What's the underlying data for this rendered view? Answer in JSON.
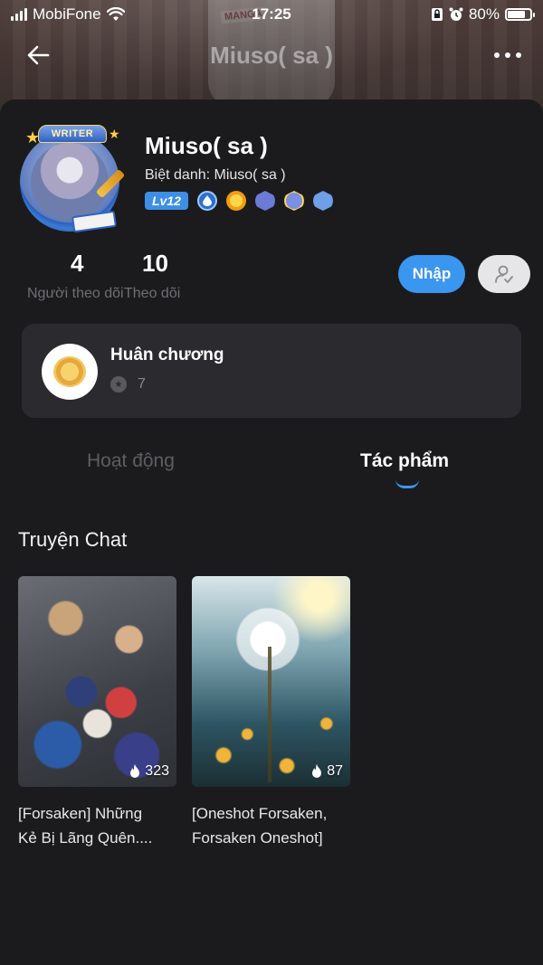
{
  "status_bar": {
    "carrier": "MobiFone",
    "time": "17:25",
    "battery": "80%"
  },
  "nav": {
    "title": "Miuso( sa )"
  },
  "banner": {
    "tag": "MANGA"
  },
  "profile": {
    "badge_label": "WRITER",
    "name": "Miuso( sa )",
    "nickname": "Biệt danh: Miuso( sa )",
    "level": "Lv12",
    "followers_count": "4",
    "followers_label": "Người theo dõi",
    "following_count": "10",
    "following_label": "Theo dõi",
    "primary_button": "Nhập"
  },
  "medal": {
    "title": "Huân chương",
    "count": "7"
  },
  "tabs": {
    "items": [
      "Hoạt động",
      "Tác phẩm"
    ],
    "active": "Tác phẩm"
  },
  "section": {
    "title": "Truyện Chat"
  },
  "cards": [
    {
      "title": "[Forsaken] Những\nKẻ Bị Lãng Quên....",
      "views": "323"
    },
    {
      "title": "[Oneshot Forsaken,\nForsaken Oneshot]",
      "views": "87"
    }
  ],
  "colors": {
    "accent": "#3b96f0",
    "background": "#1b1b1d",
    "card": "#2b2b2f"
  }
}
